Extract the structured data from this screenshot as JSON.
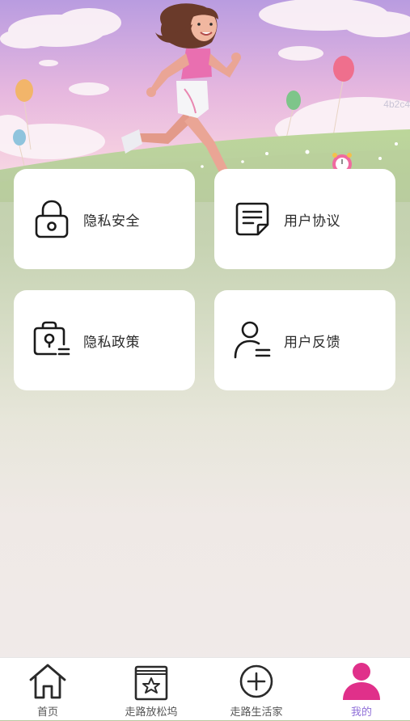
{
  "hero": {
    "watermark": "4b2c4"
  },
  "menu": {
    "items": [
      {
        "label": "隐私安全",
        "icon": "lock-icon"
      },
      {
        "label": "用户协议",
        "icon": "document-icon"
      },
      {
        "label": "隐私政策",
        "icon": "locked-bag-icon"
      },
      {
        "label": "用户反馈",
        "icon": "user-feedback-icon"
      }
    ]
  },
  "tabbar": {
    "tabs": [
      {
        "label": "首页",
        "icon": "home-icon",
        "active": false
      },
      {
        "label": "走路放松坞",
        "icon": "star-book-icon",
        "active": false
      },
      {
        "label": "走路生活家",
        "icon": "plus-circle-icon",
        "active": false
      },
      {
        "label": "我的",
        "icon": "user-icon",
        "active": true
      }
    ],
    "active_color": "#8f6fd8",
    "active_icon_color": "#e0308a"
  }
}
